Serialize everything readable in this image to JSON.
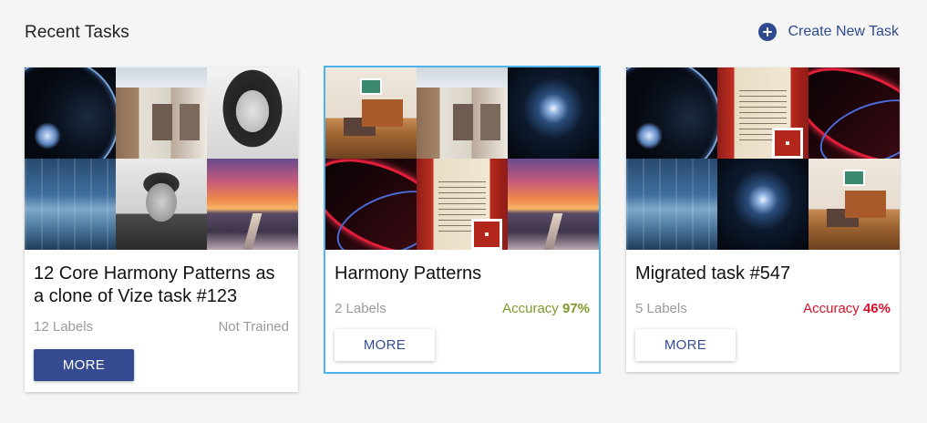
{
  "header": {
    "title": "Recent Tasks",
    "create_label": "Create New Task"
  },
  "cards": [
    {
      "title": "12 Core Harmony Patterns as a clone of Vize task #123",
      "labels": "12 Labels",
      "status": "Not Trained",
      "more_label": "MORE",
      "selected": false,
      "tiles": [
        "speedometer",
        "building",
        "woman-portrait",
        "warehouse",
        "man-portrait",
        "sunset-road"
      ]
    },
    {
      "title": "Harmony Patterns",
      "labels": "2 Labels",
      "accuracy_label": "Accuracy",
      "accuracy_value": "97%",
      "more_label": "MORE",
      "selected": true,
      "tiles": [
        "living-room",
        "building",
        "light-burst",
        "neon-lights",
        "paper-sign",
        "sunset-road"
      ]
    },
    {
      "title": "Migrated task #547",
      "labels": "5 Labels",
      "accuracy_label": "Accuracy",
      "accuracy_value": "46%",
      "more_label": "MORE",
      "selected": false,
      "tiles": [
        "speedometer",
        "paper-sign",
        "neon-lights",
        "warehouse",
        "light-burst",
        "living-room"
      ]
    }
  ],
  "colors": {
    "accent": "#354a91",
    "selected_outline": "#4cb4ec",
    "accuracy_good": "#7e9a2c",
    "accuracy_bad": "#d6122b"
  }
}
